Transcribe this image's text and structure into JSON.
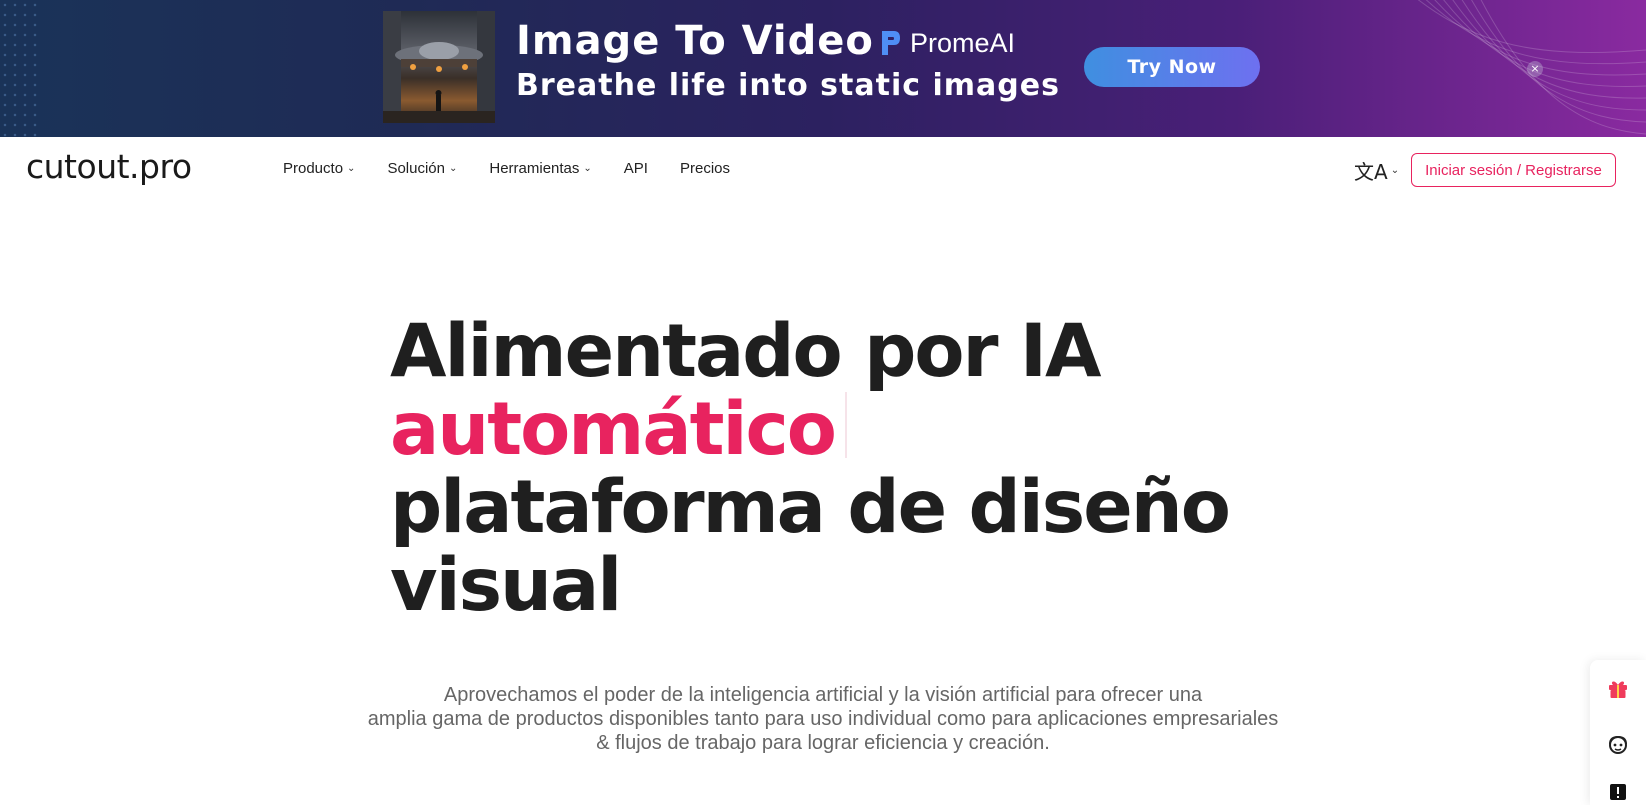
{
  "banner": {
    "title": "Image To Video",
    "subtitle": "Breathe life into static images",
    "brand": "PromeAI",
    "cta_label": "Try Now",
    "close_label": "×",
    "colors": {
      "cta_start": "#3f8fe0",
      "cta_end": "#6e70f0"
    }
  },
  "nav": {
    "logo": "cutout.pro",
    "items": [
      {
        "label": "Producto",
        "has_dropdown": true
      },
      {
        "label": "Solución",
        "has_dropdown": true
      },
      {
        "label": "Herramientas",
        "has_dropdown": true
      },
      {
        "label": "API",
        "has_dropdown": false
      },
      {
        "label": "Precios",
        "has_dropdown": false
      }
    ],
    "language_icon": "translate-icon",
    "language_glyph": "文A",
    "login_label": "Iniciar sesión / Registrarse",
    "accent_color": "#e8235f"
  },
  "hero": {
    "line1": "Alimentado por IA",
    "line2": "automático",
    "line3": "plataforma de diseño",
    "line4": "visual",
    "description_line1": "Aprovechamos el poder de la inteligencia artificial y la visión artificial para ofrecer una",
    "description_line2": "amplia gama de productos disponibles tanto para uso individual como para aplicaciones empresariales",
    "description_line3": "& flujos de trabajo para lograr eficiencia y creación."
  },
  "side_widget": {
    "icons": [
      "gift-icon",
      "support-agent-icon",
      "feedback-icon"
    ]
  }
}
